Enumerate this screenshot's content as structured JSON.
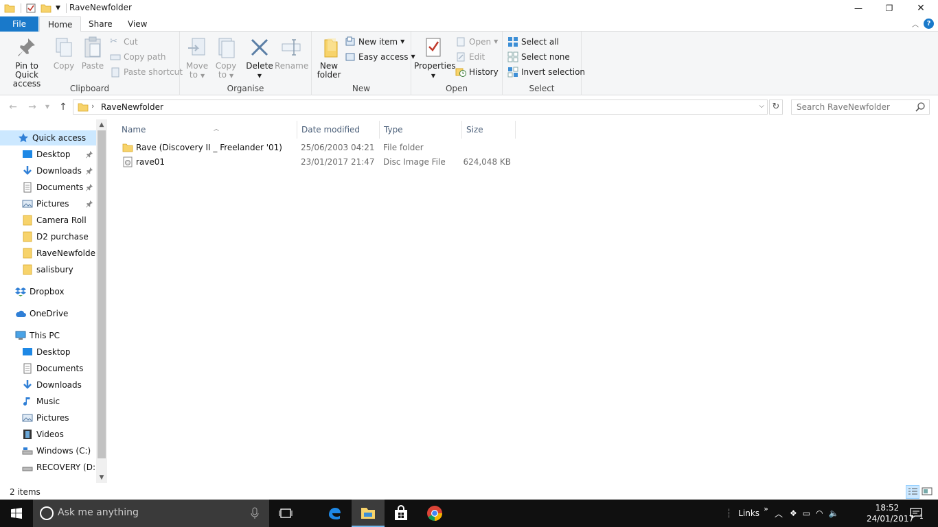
{
  "window": {
    "title": "RaveNewfolder",
    "minimize": "—",
    "maximize": "❐",
    "close": "✕"
  },
  "tabs": {
    "file": "File",
    "home": "Home",
    "share": "Share",
    "view": "View"
  },
  "ribbon": {
    "clipboard": {
      "label": "Clipboard",
      "pin_line1": "Pin to Quick",
      "pin_line2": "access",
      "copy": "Copy",
      "paste": "Paste",
      "cut": "Cut",
      "copy_path": "Copy path",
      "paste_shortcut": "Paste shortcut"
    },
    "organise": {
      "label": "Organise",
      "move_line1": "Move",
      "move_line2": "to",
      "copy_line1": "Copy",
      "copy_line2": "to",
      "delete": "Delete",
      "rename": "Rename"
    },
    "new": {
      "label": "New",
      "new_folder_line1": "New",
      "new_folder_line2": "folder",
      "new_item": "New item",
      "easy_access": "Easy access"
    },
    "open": {
      "label": "Open",
      "properties": "Properties",
      "open": "Open",
      "edit": "Edit",
      "history": "History"
    },
    "select": {
      "label": "Select",
      "select_all": "Select all",
      "select_none": "Select none",
      "invert": "Invert selection"
    }
  },
  "address": {
    "crumb": "RaveNewfolder",
    "search_placeholder": "Search RaveNewfolder"
  },
  "nav": {
    "quick_access": "Quick access",
    "qa_items": [
      {
        "label": "Desktop"
      },
      {
        "label": "Downloads"
      },
      {
        "label": "Documents"
      },
      {
        "label": "Pictures"
      },
      {
        "label": "Camera Roll"
      },
      {
        "label": "D2 purchase"
      },
      {
        "label": "RaveNewfolder"
      },
      {
        "label": "salisbury"
      }
    ],
    "dropbox": "Dropbox",
    "onedrive": "OneDrive",
    "this_pc": "This PC",
    "pc_items": [
      {
        "label": "Desktop"
      },
      {
        "label": "Documents"
      },
      {
        "label": "Downloads"
      },
      {
        "label": "Music"
      },
      {
        "label": "Pictures"
      },
      {
        "label": "Videos"
      },
      {
        "label": "Windows (C:)"
      },
      {
        "label": "RECOVERY (D:)"
      }
    ]
  },
  "columns": {
    "name": "Name",
    "date": "Date modified",
    "type": "Type",
    "size": "Size"
  },
  "files": [
    {
      "name": "Rave (Discovery II _ Freelander '01)",
      "date": "25/06/2003 04:21",
      "type": "File folder",
      "size": ""
    },
    {
      "name": "rave01",
      "date": "23/01/2017 21:47",
      "type": "Disc Image File",
      "size": "624,048 KB"
    }
  ],
  "status": {
    "count": "2 items"
  },
  "taskbar": {
    "search_text": "Ask me anything",
    "links": "Links",
    "time": "18:52",
    "date": "24/01/2017",
    "notification_count": "1"
  },
  "colors": {
    "accent": "#1979ca",
    "folder": "#f7d36b",
    "selection": "#cce8ff",
    "taskbar": "#101010"
  }
}
